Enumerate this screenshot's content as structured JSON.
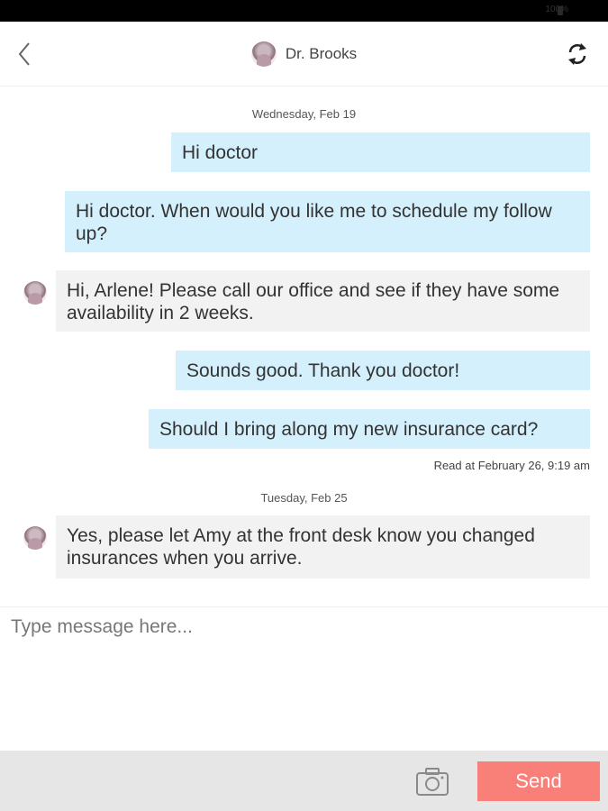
{
  "status_bar": {
    "text": "100%"
  },
  "header": {
    "contact_name": "Dr. Brooks",
    "back_icon": "chevron-left-icon",
    "refresh_icon": "refresh-icon"
  },
  "conversation": {
    "date_1": "Wednesday, Feb 19",
    "date_2": "Tuesday, Feb 25",
    "messages": [
      {
        "direction": "outgoing",
        "text": "Hi doctor"
      },
      {
        "direction": "outgoing",
        "text": "Hi doctor. When would you like me to schedule my follow up?"
      },
      {
        "direction": "incoming",
        "text": "Hi, Arlene! Please call our office and see if they have some availability in 2 weeks."
      },
      {
        "direction": "outgoing",
        "text": "Sounds good. Thank you doctor!"
      },
      {
        "direction": "outgoing",
        "text": "Should I bring along my new insurance card?"
      },
      {
        "direction": "incoming",
        "text": "Yes, please let Amy at the front desk know you changed insurances when you arrive."
      }
    ],
    "read_receipt": "Read at February 26, 9:19 am"
  },
  "composer": {
    "placeholder": "Type message here...",
    "value": ""
  },
  "bottom_bar": {
    "send_label": "Send",
    "camera_icon": "camera-icon"
  },
  "colors": {
    "outgoing_bubble": "#d4f0fc",
    "incoming_bubble": "#f2f2f2",
    "send_button": "#f97f79",
    "bottom_bar": "#e6e6e6"
  }
}
